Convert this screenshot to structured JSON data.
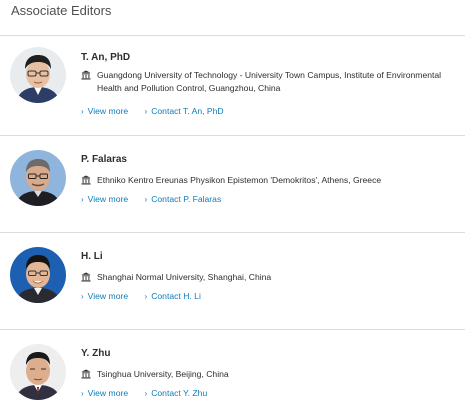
{
  "section": {
    "title": "Associate Editors"
  },
  "colors": {
    "link": "#0c7dbb",
    "divider": "#dcdcdc",
    "text": "#2e2e2e"
  },
  "editors": [
    {
      "name": "T. An, PhD",
      "affiliation": "Guangdong University of Technology - University Town Campus, Institute of Environmental Health and Pollution Control, Guangzhou, China",
      "view_more": "View more",
      "contact": "Contact T. An, PhD",
      "icon": "institution-icon"
    },
    {
      "name": "P. Falaras",
      "affiliation": "Ethniko Kentro Ereunas Physikon Epistemon 'Demokritos', Athens, Greece",
      "view_more": "View more",
      "contact": "Contact P. Falaras",
      "icon": "institution-icon"
    },
    {
      "name": "H. Li",
      "affiliation": "Shanghai Normal University, Shanghai, China",
      "view_more": "View more",
      "contact": "Contact H. Li",
      "icon": "institution-icon"
    },
    {
      "name": "Y. Zhu",
      "affiliation": "Tsinghua University, Beijing, China",
      "view_more": "View more",
      "contact": "Contact Y. Zhu",
      "icon": "institution-icon"
    }
  ]
}
